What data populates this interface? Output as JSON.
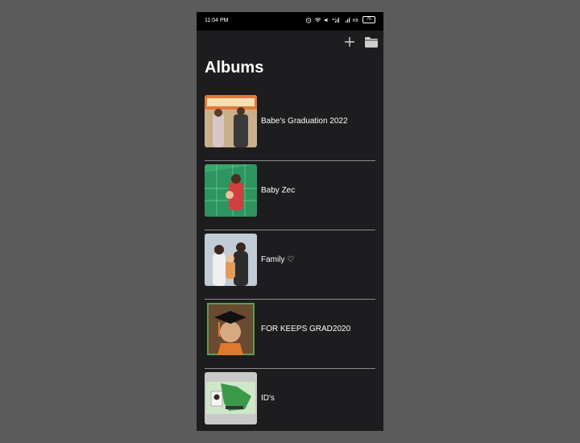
{
  "status": {
    "time": "11:04 PM",
    "battery": "76"
  },
  "header": {
    "title": "Albums",
    "add_icon": "plus-icon",
    "folder_icon": "folder-icon"
  },
  "albums": [
    {
      "name": "Babe's Graduation 2022"
    },
    {
      "name": "Baby Zec"
    },
    {
      "name": "Family ♡"
    },
    {
      "name": "FOR KEEPS GRAD2020"
    },
    {
      "name": "ID's"
    }
  ],
  "colors": {
    "background": "#5b5b5b",
    "phone_bg": "#1d1d1f",
    "divider": "#8a8a8a"
  }
}
